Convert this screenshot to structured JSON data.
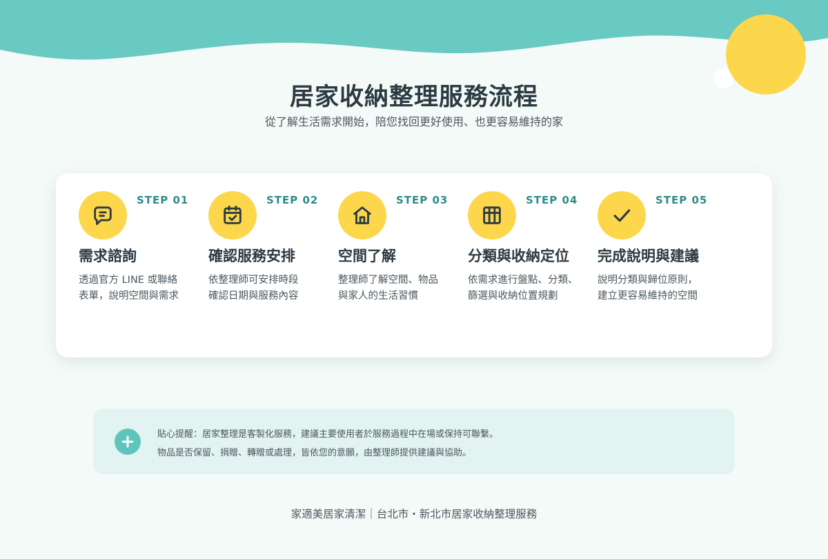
{
  "header": {
    "title": "居家收納整理服務流程",
    "subtitle": "從了解生活需求開始，陪您找回更好使用、也更容易維持的家"
  },
  "steps": [
    {
      "num": "STEP 01",
      "title": "需求諮詢",
      "desc": "透過官方 LINE 或聯絡\n表單，說明空間與需求",
      "icon": "chat-bubble-icon"
    },
    {
      "num": "STEP 02",
      "title": "確認服務安排",
      "desc": "依整理師可安排時段\n確認日期與服務內容",
      "icon": "calendar-check-icon"
    },
    {
      "num": "STEP 03",
      "title": "空間了解",
      "desc": "整理師了解空間、物品\n與家人的生活習慣",
      "icon": "home-icon"
    },
    {
      "num": "STEP 04",
      "title": "分類與收納定位",
      "desc": "依需求進行盤點、分類、\n篩選與收納位置規劃",
      "icon": "grid-icon"
    },
    {
      "num": "STEP 05",
      "title": "完成說明與建議",
      "desc": "說明分類與歸位原則，\n建立更容易維持的空間",
      "icon": "checkmark-icon"
    }
  ],
  "notice": {
    "icon": "plus-icon",
    "line1": "貼心提醒：居家整理是客製化服務，建議主要使用者於服務過程中在場或保持可聯繫。",
    "line2": "物品是否保留、捐贈、轉贈或處理，皆依您的意願，由整理師提供建議與協助。"
  },
  "footer": {
    "text": "家適美居家清潔｜台北市・新北市居家收納整理服務"
  },
  "colors": {
    "teal": "#69c9c3",
    "yellow": "#fdd74b",
    "accent_text": "#2e8b86",
    "background": "#f4faf8"
  }
}
